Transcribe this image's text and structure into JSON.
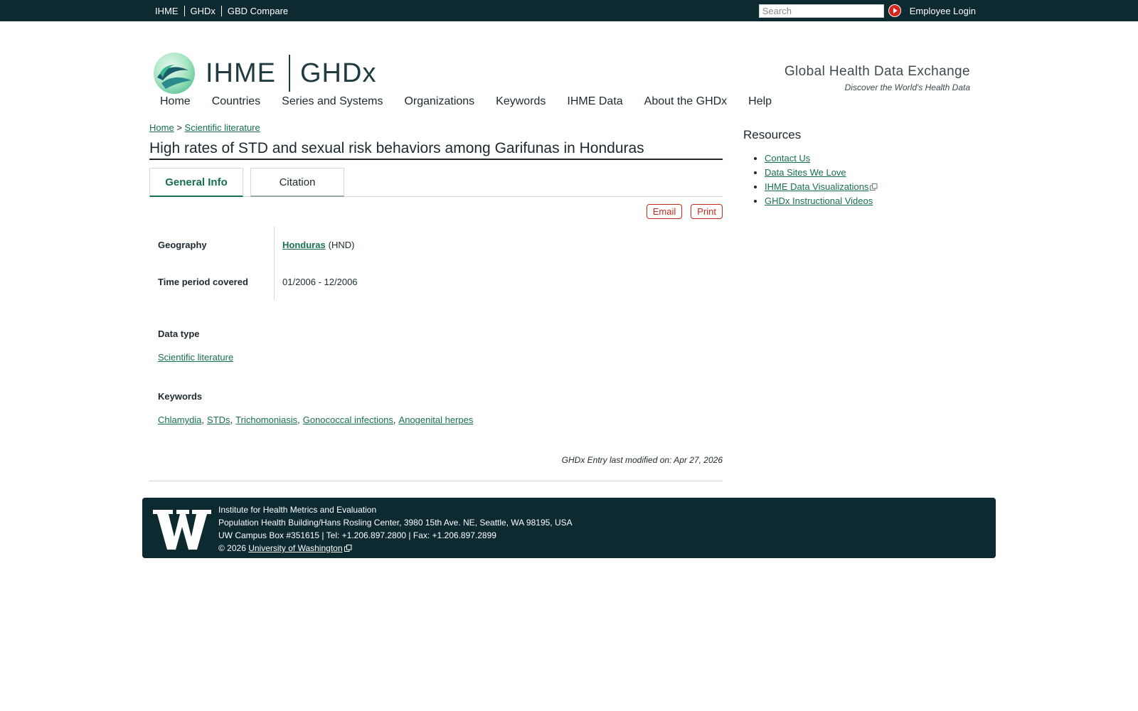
{
  "topbar": {
    "links": [
      "IHME",
      "GHDx",
      "GBD Compare"
    ],
    "search_placeholder": "Search",
    "employee_login": "Employee Login"
  },
  "header": {
    "logo_ihme": "IHME",
    "logo_ghdx": "GHDx",
    "tagline_title": "Global Health Data Exchange",
    "tagline_sub": "Discover the World's Health Data"
  },
  "nav": {
    "items": [
      "Home",
      "Countries",
      "Series and Systems",
      "Organizations",
      "Keywords",
      "IHME Data",
      "About the GHDx",
      "Help"
    ]
  },
  "breadcrumb": {
    "home": "Home",
    "separator": ">",
    "current": "Scientific literature"
  },
  "page": {
    "title": "High rates of STD and sexual risk behaviors among Garifunas in Honduras",
    "tabs": [
      "General Info",
      "Citation"
    ],
    "email_label": "Email",
    "print_label": "Print",
    "geography_label": "Geography",
    "geography_value": "Honduras",
    "geography_code": "(HND)",
    "time_label": "Time period covered",
    "time_value": "01/2006 - 12/2006",
    "datatype_label": "Data type",
    "datatype_value": "Scientific literature",
    "keywords_label": "Keywords",
    "keywords": [
      "Chlamydia",
      "STDs",
      "Trichomoniasis",
      "Gonococcal infections",
      "Anogenital herpes"
    ],
    "modified": "GHDx Entry last modified on: Apr 27, 2026"
  },
  "sidebar": {
    "title": "Resources",
    "links": [
      "Contact Us",
      "Data Sites We Love",
      "IHME Data Visualizations",
      "GHDx Instructional Videos"
    ]
  },
  "footer": {
    "line1": "Institute for Health Metrics and Evaluation",
    "line2": "Population Health Building/Hans Rosling Center, 3980 15th Ave. NE, Seattle, WA 98195, USA",
    "line3": "UW Campus Box #351615 | Tel: +1.206.897.2800 | Fax: +1.206.897.2899",
    "copyright": "© 2026",
    "uw_link": "University of Washington"
  },
  "colors": {
    "dark_teal": "#0d2a30",
    "link_green": "#16704f",
    "action_red": "#c42b1c"
  }
}
